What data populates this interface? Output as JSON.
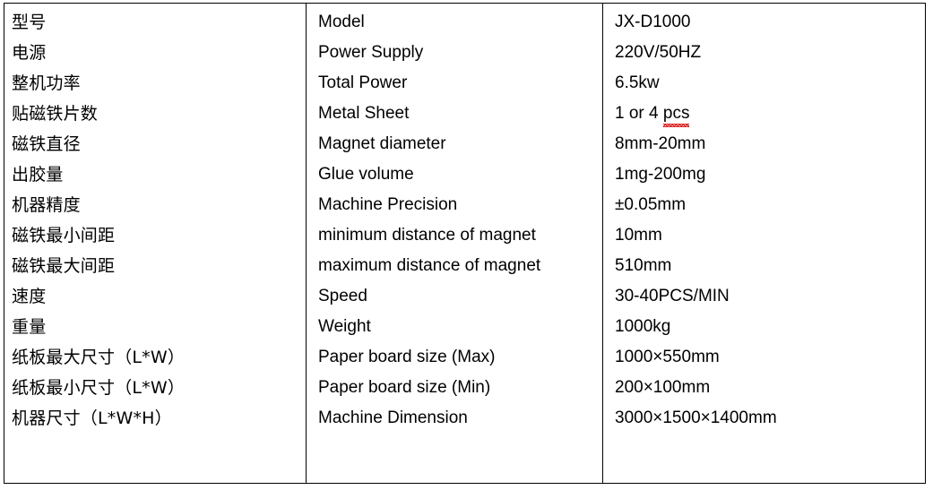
{
  "document": {
    "kind": "specification-table",
    "column_count": 3,
    "row_count": 14,
    "border_color": "#000000",
    "text_color": "#000000",
    "background_color": "#ffffff",
    "spellcheck_underline_color": "#d81414"
  },
  "table": {
    "columns": [
      {
        "key": "label_cn",
        "name": "chinese-label"
      },
      {
        "key": "label_en",
        "name": "english-label"
      },
      {
        "key": "value",
        "name": "value"
      }
    ],
    "rows": [
      {
        "label_cn": "型号",
        "label_en": "Model",
        "value": "JX-D1000"
      },
      {
        "label_cn": "电源",
        "label_en": "Power Supply",
        "value": "220V/50HZ"
      },
      {
        "label_cn": "整机功率",
        "label_en": "Total Power",
        "value": "6.5kw"
      },
      {
        "label_cn": "贴磁铁片数",
        "label_en": "Metal Sheet",
        "value": "1 or 4 pcs",
        "value_prefix": "1 or 4 ",
        "value_misspelled": "pcs"
      },
      {
        "label_cn": "磁铁直径",
        "label_en": "Magnet diameter",
        "value": "8mm-20mm"
      },
      {
        "label_cn": "出胶量",
        "label_en": "Glue volume",
        "value": "1mg-200mg"
      },
      {
        "label_cn": "机器精度",
        "label_en": "Machine Precision",
        "value": "±0.05mm"
      },
      {
        "label_cn": "磁铁最小间距",
        "label_en": "minimum distance of magnet",
        "value": "10mm"
      },
      {
        "label_cn": "磁铁最大间距",
        "label_en": "maximum distance of magnet",
        "value": "510mm"
      },
      {
        "label_cn": "速度",
        "label_en": "Speed",
        "value": "30-40PCS/MIN"
      },
      {
        "label_cn": "重量",
        "label_en": "Weight",
        "value": "1000kg"
      },
      {
        "label_cn": "纸板最大尺寸（L*W）",
        "label_en": "Paper board size (Max)",
        "value": "1000×550mm"
      },
      {
        "label_cn": "纸板最小尺寸（L*W）",
        "label_en": "Paper board size (Min)",
        "value": "200×100mm"
      },
      {
        "label_cn": "机器尺寸（L*W*H）",
        "label_en": "Machine Dimension",
        "value": "3000×1500×1400mm"
      }
    ]
  }
}
